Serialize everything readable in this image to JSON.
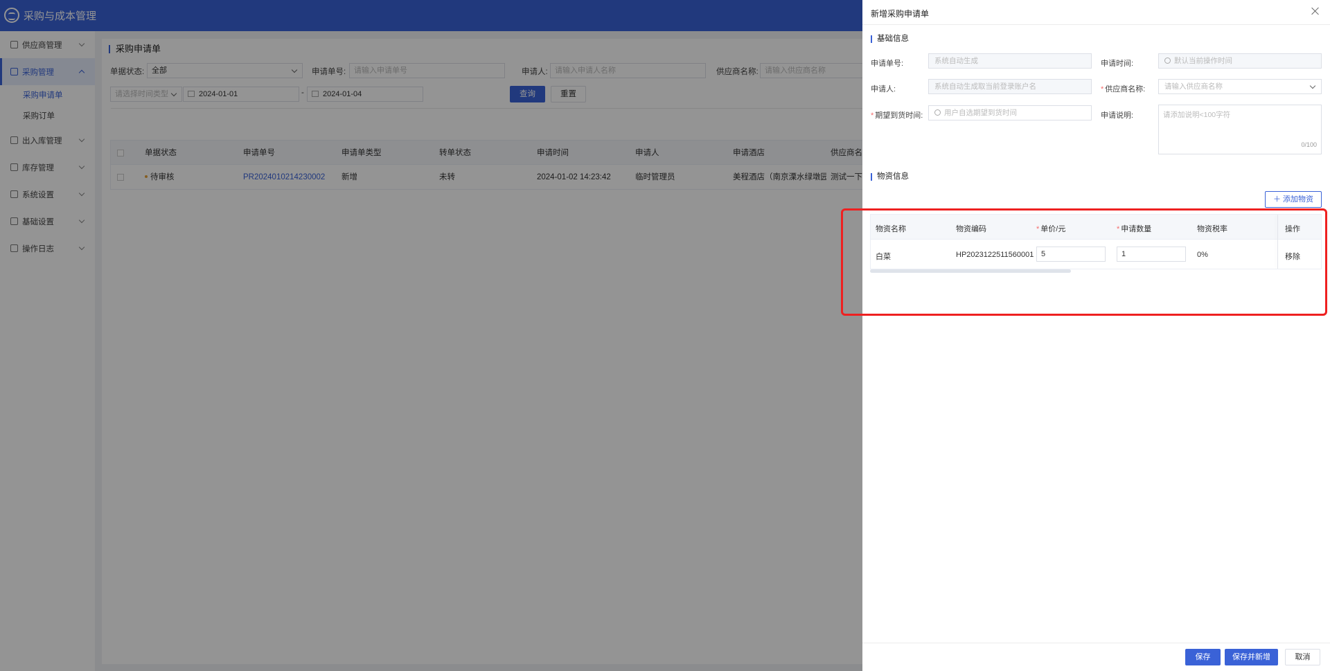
{
  "app": {
    "title": "采购与成本管理"
  },
  "sidebar": {
    "items": [
      {
        "label": "供应商管理"
      },
      {
        "label": "采购管理"
      },
      {
        "label": "出入库管理"
      },
      {
        "label": "库存管理"
      },
      {
        "label": "系统设置"
      },
      {
        "label": "基础设置"
      },
      {
        "label": "操作日志"
      }
    ],
    "sub_items": [
      {
        "label": "采购申请单"
      },
      {
        "label": "采购订单"
      }
    ]
  },
  "page": {
    "title": "采购申请单",
    "filters": {
      "status_label": "单据状态:",
      "status_value": "全部",
      "no_label": "申请单号:",
      "no_placeholder": "请输入申请单号",
      "applicant_label": "申请人:",
      "applicant_placeholder": "请输入申请人名称",
      "supplier_label": "供应商名称:",
      "supplier_placeholder": "请输入供应商名称",
      "time_type_placeholder": "请选择时间类型",
      "date_from": "2024-01-01",
      "date_sep": "-",
      "date_to": "2024-01-04",
      "query_label": "查询",
      "reset_label": "重置"
    },
    "table": {
      "columns": [
        "单据状态",
        "申请单号",
        "申请单类型",
        "转单状态",
        "申请时间",
        "申请人",
        "申请酒店",
        "供应商名"
      ],
      "rows": [
        {
          "status": "待审核",
          "no": "PR2024010214230002",
          "type": "新增",
          "transfer": "未转",
          "time": "2024-01-02 14:23:42",
          "applicant": "临时管理员",
          "hotel": "美程酒店（南京溧水绿墩园店）",
          "supplier": "测试一下"
        }
      ]
    }
  },
  "drawer": {
    "title": "新增采购申请单",
    "basic_section": "基础信息",
    "fields": {
      "no_label": "申请单号:",
      "no_placeholder": "系统自动生成",
      "time_label": "申请时间:",
      "time_placeholder": "默认当前操作时间",
      "applicant_label": "申请人:",
      "applicant_placeholder": "系统自动生成取当前登录账户名",
      "supplier_label": "供应商名称:",
      "supplier_placeholder": "请输入供应商名称",
      "expect_label": "期望到货时间:",
      "expect_placeholder": "用户自选期望到货时间",
      "desc_label": "申请说明:",
      "desc_placeholder": "请添加说明<100字符",
      "desc_count": "0/100",
      "required_mark": "*"
    },
    "material_section": "物资信息",
    "add_label": "添加物资",
    "material_table": {
      "columns": {
        "name": "物资名称",
        "code": "物资编码",
        "price": "单价/元",
        "qty": "申请数量",
        "tax": "物资税率",
        "action": "操作"
      },
      "rows": [
        {
          "name": "白菜",
          "code": "HP2023122511560001",
          "price": "5",
          "qty": "1",
          "tax": "0%",
          "action": "移除"
        }
      ]
    },
    "footer": {
      "save_label": "保存",
      "save_new_label": "保存并新增",
      "cancel_label": "取消"
    }
  },
  "colors": {
    "primary": "#3a62d7",
    "highlight": "#ee2020",
    "required": "#f56c6c"
  }
}
